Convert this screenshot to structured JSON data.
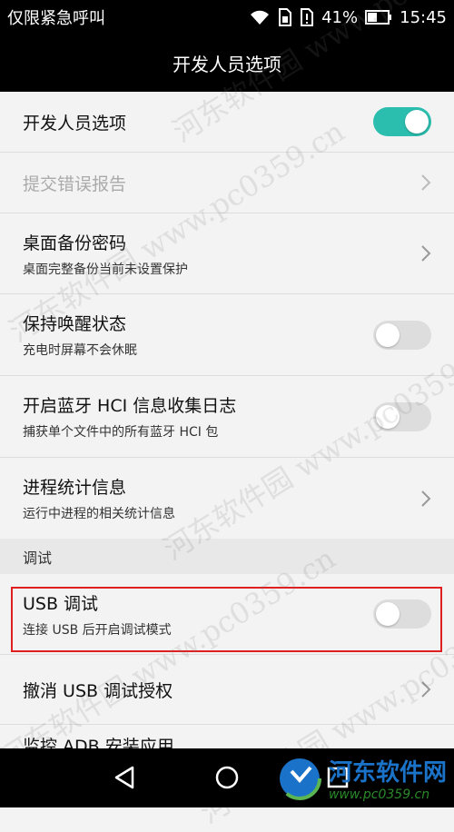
{
  "status_bar": {
    "carrier": "仅限紧急呼叫",
    "battery": "41%",
    "time": "15:45"
  },
  "title_bar": {
    "title": "开发人员选项"
  },
  "list": {
    "developer_options": {
      "title": "开发人员选项",
      "enabled": true
    },
    "bug_report": {
      "title": "提交错误报告"
    },
    "backup_password": {
      "title": "桌面备份密码",
      "subtitle": "桌面完整备份当前未设置保护"
    },
    "stay_awake": {
      "title": "保持唤醒状态",
      "subtitle": "充电时屏幕不会休眠",
      "enabled": false
    },
    "bt_hci_log": {
      "title": "开启蓝牙 HCI 信息收集日志",
      "subtitle": "捕获单个文件中的所有蓝牙 HCI 包",
      "enabled": false
    },
    "process_stats": {
      "title": "进程统计信息",
      "subtitle": "运行中进程的相关统计信息"
    },
    "section_debug": "调试",
    "usb_debugging": {
      "title": "USB 调试",
      "subtitle": "连接 USB 后开启调试模式",
      "enabled": false
    },
    "revoke_usb": {
      "title": "撤消 USB 调试授权"
    },
    "partial_next": "监控 ADB 安装应用"
  },
  "brand": {
    "name": "河东软件网",
    "url": "www.pc0359.cn"
  },
  "watermark": "河东软件园 www.pc0359.cn",
  "colors": {
    "accent": "#2bbdae",
    "highlight": "#e02020",
    "brand": "#1a73c8"
  },
  "nav_icons": [
    "back-icon",
    "home-icon",
    "recents-icon"
  ]
}
